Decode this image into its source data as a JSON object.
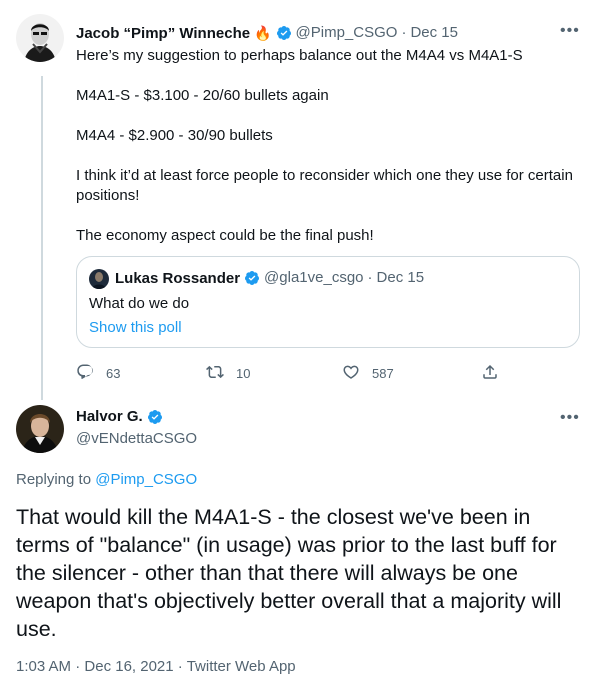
{
  "tweet1": {
    "name": "Jacob “Pimp” Winneche",
    "name_emoji": "🔥",
    "handle": "@Pimp_CSGO",
    "sep": "·",
    "date": "Dec 15",
    "lines": [
      "Here’s my suggestion to perhaps balance out the M4A4 vs M4A1-S",
      "M4A1-S - $3.100 - 20/60 bullets again",
      "M4A4 - $2.900 - 30/90 bullets",
      "I think it’d at least force people to reconsider which one they use for certain positions!",
      "The economy aspect could be the final push!"
    ],
    "quote": {
      "name": "Lukas Rossander",
      "handle": "@gla1ve_csgo",
      "sep": "·",
      "date": "Dec 15",
      "text": "What do we do",
      "poll_link": "Show this poll"
    },
    "actions": {
      "replies": "63",
      "retweets": "10",
      "likes": "587"
    }
  },
  "tweet2": {
    "name": "Halvor G.",
    "handle": "@vENdettaCSGO",
    "replying_prefix": "Replying to",
    "replying_to": "@Pimp_CSGO",
    "text": "That would kill the M4A1-S - the closest we've been in terms of \"balance\" (in usage) was prior to the last buff for the silencer - other than that there will always be one weapon that's objectively better overall that a majority will use.",
    "time": "1:03 AM",
    "sep1": "·",
    "date": "Dec 16, 2021",
    "sep2": "·",
    "source": "Twitter Web App"
  },
  "icons": {
    "more": "more-icon",
    "verified": "verified-badge-icon",
    "reply": "reply-icon",
    "retweet": "retweet-icon",
    "like": "like-icon",
    "share": "share-icon"
  },
  "colors": {
    "accent": "#1d9bf0",
    "muted": "#536471",
    "text": "#0f1419",
    "border": "#cfd9de"
  }
}
